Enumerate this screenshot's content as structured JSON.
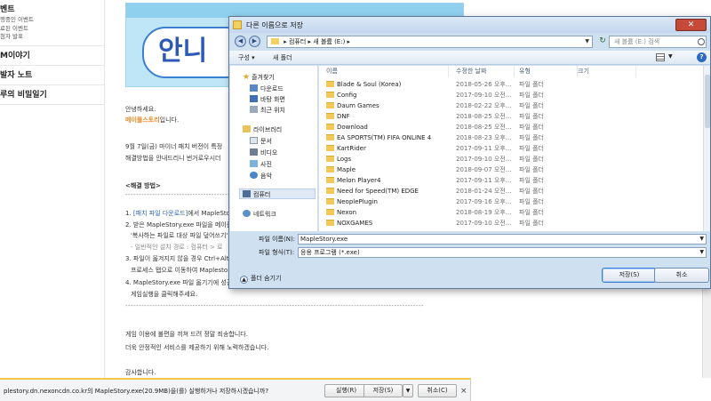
{
  "left_nav": {
    "event_head": "벤트",
    "event_sub": [
      "행중인 이벤트",
      "료된 이벤트",
      "첨자 발표"
    ],
    "items": [
      "M이야기",
      "발자 노트",
      "루의 비밀일기"
    ]
  },
  "banner": {
    "title": "안니"
  },
  "article": {
    "greeting": "안녕하세요.",
    "brand": "메이플스토리",
    "brand_suffix": "입니다.",
    "line3": "9월 7일(금) 마이너 패치 버전이 특정",
    "line4": "해결방법을 안내드리니 번거로우시더",
    "heading": "<해결 방법>",
    "divider": "---------------------------------------------------------",
    "step1_a": "1. ",
    "step1_link": "[패치 파일 다운로드]",
    "step1_b": "에서 MapleStory",
    "step2": "2. 받은 MapleStory.exe 파일을 메이플",
    "step2_sub": "'복사하는 파일로 대상 파일 덮어쓰기'",
    "step2_path": "- 일반적인 설치 경로 : 컴퓨터 > 로",
    "step3": "3. 파일이 옮겨지지 않을 경우 Ctrl+Alt+",
    "step3_sub": "프로세스 탭으로 이동하여 Maplesto",
    "step4": "4. MapleStory.exe 파일 옮기기에 성공",
    "step4_sub": "게임실행을 클릭해주세요.",
    "divider2": "---------------------------------------------------------------------------------------------------------------",
    "apology1": "게임 이용에 불편을 끼쳐 드려 정말 죄송합니다.",
    "apology2": "더욱 안정적인 서비스를 제공하기 위해 노력하겠습니다.",
    "thanks": "감사합니다."
  },
  "download_bar": {
    "message": "plestory.dn.nexoncdn.co.kr의 MapleStory.exe(20.9MB)을(를) 실행하거나 저장하시겠습니까?",
    "run_label": "실행(R)",
    "save_label": "저장(S)",
    "cancel_label": "취소(C)",
    "close_glyph": "×"
  },
  "dialog": {
    "title": "다른 이름으로 저장",
    "close_glyph": "✕",
    "address_parts": [
      "컴퓨터",
      "새 볼륨 (E:)"
    ],
    "search_placeholder": "새 볼륨 (E:) 검색",
    "toolbar": {
      "organize": "구성 ▾",
      "new_folder": "새 폴더"
    },
    "columns": {
      "name": "이름",
      "date": "수정한 날짜",
      "type": "유형",
      "size": "크기"
    },
    "nav": {
      "favorites": "즐겨찾기",
      "downloads": "다운로드",
      "desktop": "바탕 화면",
      "recent": "최근 위치",
      "libraries": "라이브러리",
      "documents": "문서",
      "videos": "비디오",
      "pictures": "사진",
      "music": "음악",
      "computer": "컴퓨터",
      "network": "네트워크"
    },
    "files": [
      {
        "name": "Blade & Soul (Korea)",
        "date": "2018-05-26 오후...",
        "type": "파일 폴더"
      },
      {
        "name": "Config",
        "date": "2017-09-10 오전...",
        "type": "파일 폴더"
      },
      {
        "name": "Daum Games",
        "date": "2018-02-22 오후...",
        "type": "파일 폴더"
      },
      {
        "name": "DNF",
        "date": "2018-08-25 오전...",
        "type": "파일 폴더"
      },
      {
        "name": "Download",
        "date": "2018-08-25 오전...",
        "type": "파일 폴더"
      },
      {
        "name": "EA SPORTS(TM) FIFA ONLINE 4",
        "date": "2018-08-23 오후...",
        "type": "파일 폴더"
      },
      {
        "name": "KartRider",
        "date": "2017-09-11 오후...",
        "type": "파일 폴더"
      },
      {
        "name": "Logs",
        "date": "2017-09-10 오전...",
        "type": "파일 폴더"
      },
      {
        "name": "Maple",
        "date": "2018-09-07 오전...",
        "type": "파일 폴더"
      },
      {
        "name": "Melon Player4",
        "date": "2017-09-11 오후...",
        "type": "파일 폴더"
      },
      {
        "name": "Need for Speed(TM) EDGE",
        "date": "2018-01-24 오전...",
        "type": "파일 폴더"
      },
      {
        "name": "NeoplePlugin",
        "date": "2017-09-16 오후...",
        "type": "파일 폴더"
      },
      {
        "name": "Nexon",
        "date": "2018-08-19 오후...",
        "type": "파일 폴더"
      },
      {
        "name": "NOXGAMES",
        "date": "2017-09-10 오전...",
        "type": "파일 폴더"
      }
    ],
    "filename_label": "파일 이름(N):",
    "filename_value": "MapleStory.exe",
    "filetype_label": "파일 형식(T):",
    "filetype_value": "응용 프로그램 (*.exe)",
    "hide_folders": "폴더 숨기기",
    "save_button": "저장(S)",
    "cancel_button": "취소"
  },
  "colors": {
    "orange": "#e98a25",
    "link_blue": "#2d66b5",
    "dialog_frame": "#cfe0f1",
    "dl_accent": "#f3c74a"
  }
}
